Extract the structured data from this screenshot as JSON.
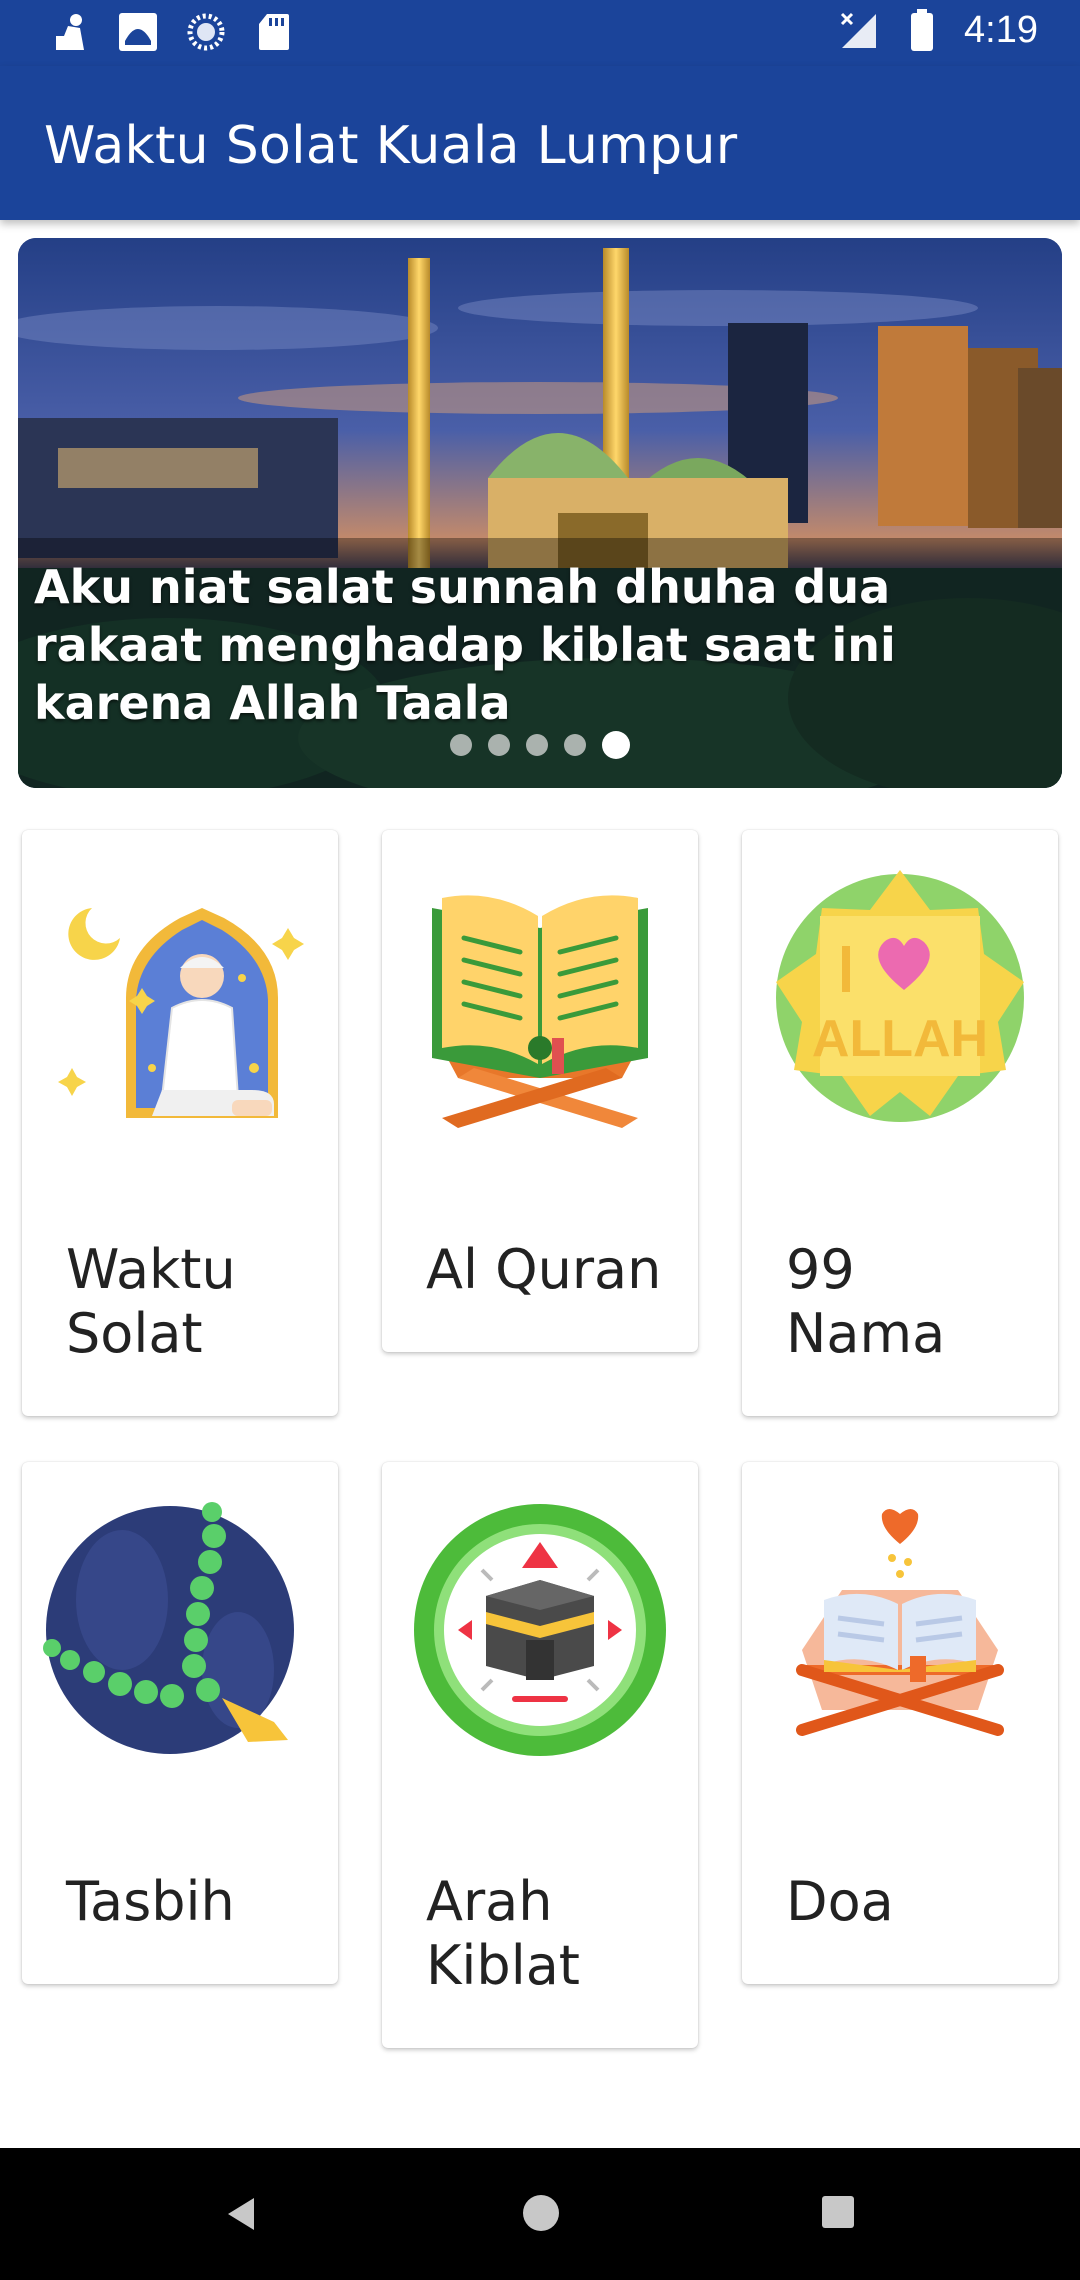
{
  "status_bar": {
    "time": "4:19",
    "left_icons": [
      "prayer-person-icon",
      "mosque-icon",
      "loading-circle-icon",
      "sd-card-icon"
    ],
    "right_icons": [
      "no-signal-icon",
      "battery-icon"
    ]
  },
  "app_bar": {
    "title": "Waktu Solat Kuala Lumpur"
  },
  "banner": {
    "caption": "Aku niat salat sunnah dhuha dua rakaat menghadap kiblat saat ini karena Allah Taala",
    "slides": 5,
    "active_slide": 5
  },
  "menu": [
    {
      "label": "Waktu\nSolat",
      "icon": "praying-man-icon"
    },
    {
      "label": "Al Quran",
      "icon": "quran-icon"
    },
    {
      "label": "99\nNama",
      "icon": "i-love-allah-icon"
    },
    {
      "label": "Tasbih",
      "icon": "tasbih-beads-icon"
    },
    {
      "label": "Arah\nKiblat",
      "icon": "kaaba-compass-icon"
    },
    {
      "label": "Doa",
      "icon": "book-on-stand-icon"
    }
  ],
  "icon_texts": {
    "allah_badge": "ALLAH",
    "allah_badge_prefix": "I"
  },
  "nav_bar": {
    "buttons": [
      "back-icon",
      "home-icon",
      "recents-icon"
    ]
  },
  "colors": {
    "primary": "#1b449a"
  }
}
